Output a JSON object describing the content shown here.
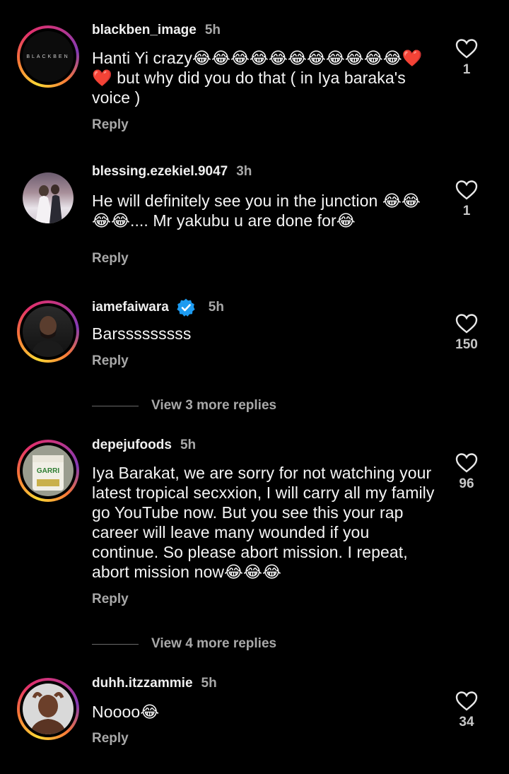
{
  "comments": [
    {
      "username": "blackben_image",
      "time": "5h",
      "text": "Hanti Yi crazy😂😂😂😂😂😂😂😂😂😂😂❤️❤️ but why did you do that ( in Iya baraka's voice )",
      "avatar_text": "BLACKBEN",
      "likes": "1",
      "reply_label": "Reply"
    },
    {
      "username": "blessing.ezekiel.9047",
      "time": "3h",
      "text": "He will definitely see you in the junction 😂😂😂😂.... Mr yakubu u are done for😂",
      "likes": "1",
      "reply_label": "Reply"
    },
    {
      "username": "iamefaiwara",
      "time": "5h",
      "text": "Barsssssssss",
      "likes": "150",
      "reply_label": "Reply",
      "view_more": "View 3 more replies"
    },
    {
      "username": "depejufoods",
      "time": "5h",
      "text": "Iya Barakat, we are sorry for not watching your latest tropical secxxion, I will carry all my family go YouTube now. But you see this your rap career will leave many wounded if you continue. So please abort mission. I repeat, abort mission now😂😂😂",
      "avatar_text": "GARRI",
      "likes": "96",
      "reply_label": "Reply",
      "view_more": "View 4 more replies"
    },
    {
      "username": "duhh.itzzammie",
      "time": "5h",
      "text": "Noooo😂",
      "likes": "34",
      "reply_label": "Reply"
    }
  ],
  "colors": {
    "background": "#000000",
    "verified": "#1d9bf0",
    "secondary_text": "#a8a8a8"
  }
}
